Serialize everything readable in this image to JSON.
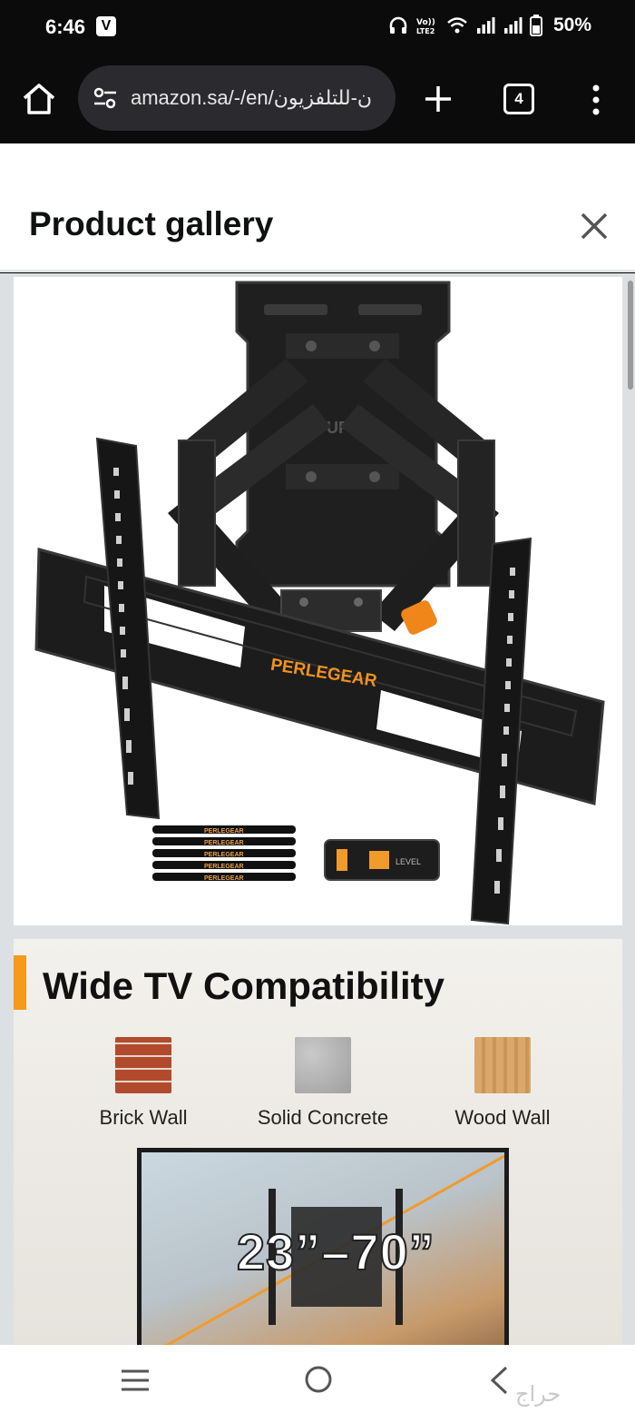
{
  "status_bar": {
    "time": "6:46",
    "app_badge": "V",
    "battery": "50%"
  },
  "browser": {
    "url": "amazon.sa/-/en/ن-للتلفزيون",
    "tab_count": "4"
  },
  "gallery": {
    "title": "Product gallery",
    "image1": {
      "brand": "PERLEGEAR",
      "strap_labels": [
        "PERLEGEAR",
        "PERLEGEAR",
        "PERLEGEAR",
        "PERLEGEAR",
        "PERLEGEAR"
      ],
      "level_label": "LEVEL",
      "plate_text": "UP"
    },
    "image2": {
      "title": "Wide TV Compatibility",
      "materials": [
        "Brick Wall",
        "Solid Concrete",
        "Wood Wall"
      ],
      "size_range": "23”–70”"
    }
  },
  "colors": {
    "accent_orange": "#f59a1b",
    "bracket_black": "#1c1c1c"
  },
  "watermark": "حراج"
}
